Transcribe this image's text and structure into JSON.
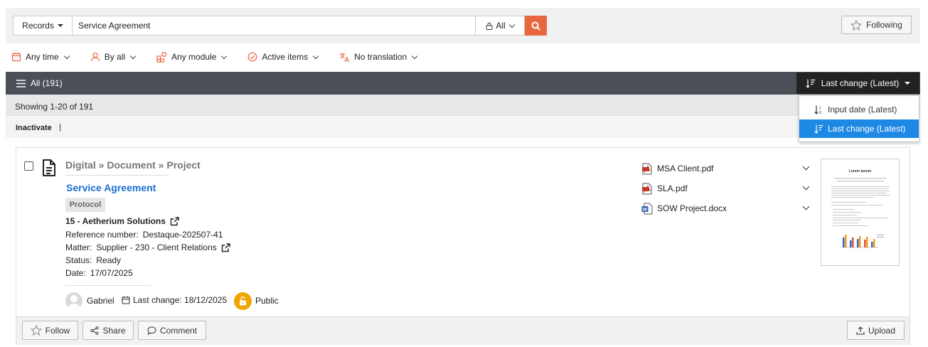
{
  "search": {
    "records_label": "Records",
    "query": "Service Agreement",
    "scope_label": "All"
  },
  "following_label": "Following",
  "filters": [
    {
      "label": "Any time",
      "icon": "calendar-icon"
    },
    {
      "label": "By all",
      "icon": "user-icon"
    },
    {
      "label": "Any module",
      "icon": "modules-icon"
    },
    {
      "label": "Active items",
      "icon": "check-circle-icon"
    },
    {
      "label": "No translation",
      "icon": "translate-icon"
    }
  ],
  "list_header": {
    "all_label": "All (191)",
    "sort_label": "Last change (Latest)"
  },
  "sort_options": [
    {
      "label": "Input date (Latest)",
      "active": false
    },
    {
      "label": "Last change (Latest)",
      "active": true
    }
  ],
  "showing_text": "Showing 1-20 of 191",
  "actions": {
    "inactivate_label": "Inactivate",
    "separator": "|"
  },
  "record": {
    "breadcrumb": "Digital » Document » Project",
    "title": "Service Agreement",
    "tag": "Protocol",
    "company": "15 - Aetherium Solutions",
    "reference_label": "Reference number:",
    "reference_value": "Destaque-202507-41",
    "matter_label": "Matter:",
    "matter_value": "Supplier - 230 - Client Relations",
    "status_label": "Status:",
    "status_value": "Ready",
    "date_label": "Date:",
    "date_value": "17/07/2025",
    "author": "Gabriel",
    "last_change": "Last change: 18/12/2025",
    "visibility": "Public",
    "files": [
      {
        "name": "MSA Client.pdf",
        "type": "pdf"
      },
      {
        "name": "SLA.pdf",
        "type": "pdf"
      },
      {
        "name": "SOW Project.docx",
        "type": "docx"
      }
    ],
    "thumbnail_title": "Lorem ipsum"
  },
  "card_actions": {
    "follow_label": "Follow",
    "share_label": "Share",
    "comment_label": "Comment",
    "upload_label": "Upload"
  },
  "colors": {
    "accent": "#e8673e",
    "header_bg": "#4a4f58",
    "link": "#1a6fd1",
    "public": "#f0a500",
    "dropdown_active": "#1e88e5"
  }
}
